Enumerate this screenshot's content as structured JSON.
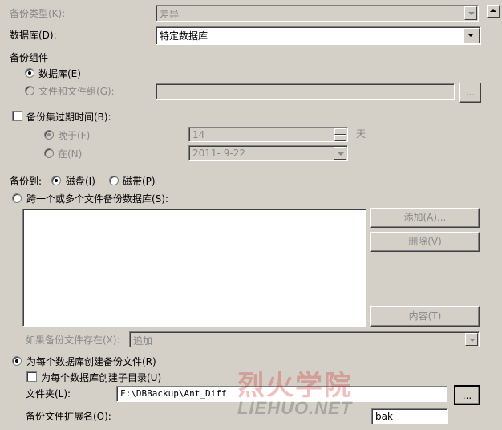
{
  "backup_type": {
    "label": "备份类型(K):",
    "value": "差异"
  },
  "database": {
    "label": "数据库(D):",
    "value": "特定数据库"
  },
  "backup_component": {
    "label": "备份组件",
    "database_option": "数据库(E)",
    "files_option": "文件和文件组(G):",
    "browse_label": "..."
  },
  "expiry": {
    "label": "备份集过期时间(B):",
    "after_label": "晚于(F)",
    "after_value": "14",
    "days_unit": "天",
    "on_label": "在(N)",
    "on_value": "2011- 9-22"
  },
  "backup_to": {
    "label": "备份到:",
    "disk_label": "磁盘(I)",
    "tape_label": "磁带(P)"
  },
  "span_files": {
    "label": "跨一个或多个文件备份数据库(S):"
  },
  "buttons": {
    "add": "添加(A)...",
    "remove": "删除(V)",
    "contents": "内容(T)"
  },
  "if_exists": {
    "label": "如果备份文件存在(X):",
    "value": "追加"
  },
  "per_db": {
    "create_file_label": "为每个数据库创建备份文件(R)",
    "create_subdir_label": "为每个数据库创建子目录(U)",
    "folder_label": "文件夹(L):",
    "folder_value": "F:\\DBBackup\\Ant_Diff",
    "folder_browse": "...",
    "ext_label": "备份文件扩展名(O):",
    "ext_value": "bak"
  },
  "watermark": {
    "cn": "烈火学院",
    "en": "LIEHUO.NET"
  }
}
